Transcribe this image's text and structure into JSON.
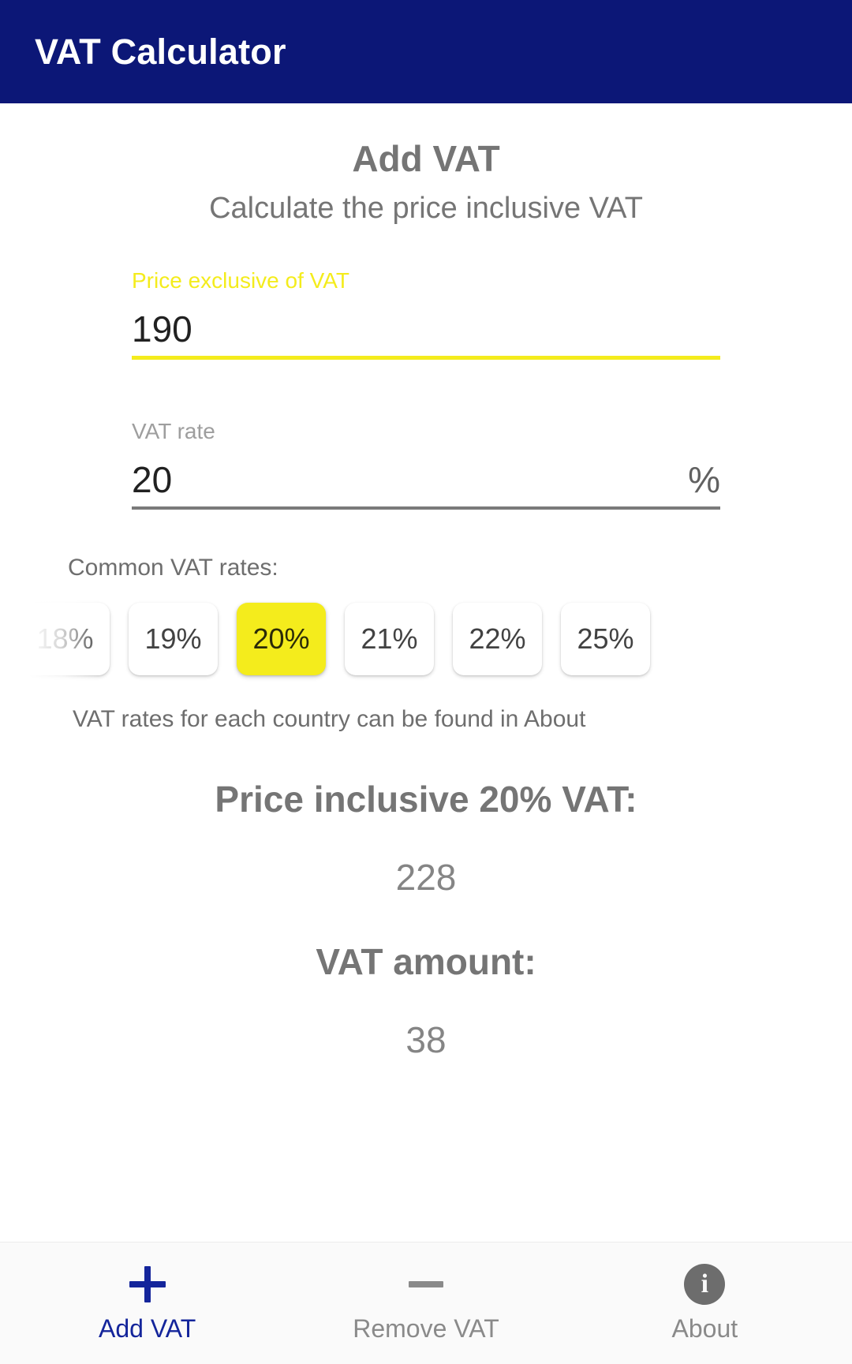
{
  "appbar": {
    "title": "VAT Calculator",
    "background": "#0C1777",
    "text_color": "#FFFFFF"
  },
  "screen": {
    "title": "Add VAT",
    "subtitle": "Calculate the price inclusive VAT"
  },
  "accent": {
    "yellow": "#F4EC1C",
    "navy": "#14259B",
    "grey_text": "#757575"
  },
  "form": {
    "price_field": {
      "label": "Price exclusive of VAT",
      "value": "190",
      "placeholder": "0",
      "focused": true
    },
    "rate_field": {
      "label": "VAT rate",
      "value": "20",
      "placeholder": "0",
      "suffix": "%",
      "focused": false
    }
  },
  "chips": {
    "caption": "Common VAT rates:",
    "note": "VAT rates for each country can be found in About",
    "selected": "20%",
    "items": [
      {
        "label": "18%",
        "selected": false
      },
      {
        "label": "19%",
        "selected": false
      },
      {
        "label": "20%",
        "selected": true
      },
      {
        "label": "21%",
        "selected": false
      },
      {
        "label": "22%",
        "selected": false
      },
      {
        "label": "25%",
        "selected": false
      }
    ]
  },
  "results": [
    {
      "heading": "Price inclusive 20% VAT:",
      "value": "228"
    },
    {
      "heading": "VAT amount:",
      "value": "38"
    }
  ],
  "bottom_nav": {
    "items": [
      {
        "label": "Add VAT",
        "icon": "plus-icon",
        "active": true
      },
      {
        "label": "Remove VAT",
        "icon": "minus-icon",
        "active": false
      },
      {
        "label": "About",
        "icon": "info-icon",
        "active": false
      }
    ]
  }
}
